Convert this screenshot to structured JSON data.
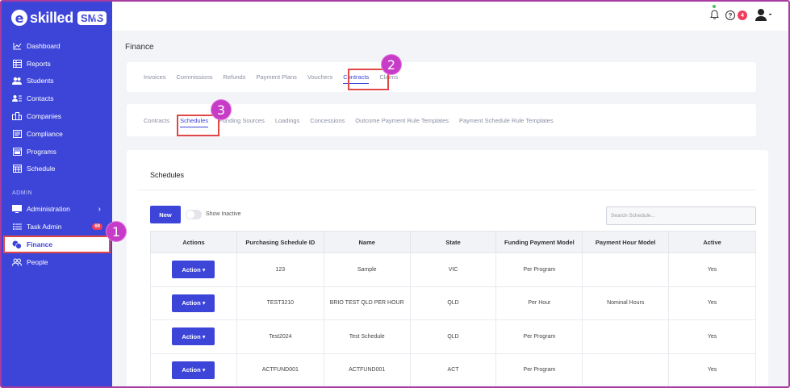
{
  "sidebar": {
    "logo": {
      "e": "e",
      "text": "skilled",
      "badge": "SMS"
    },
    "collapse_icon": "«",
    "items": [
      {
        "label": "Dashboard",
        "icon": "chart-line-icon"
      },
      {
        "label": "Reports",
        "icon": "table-icon"
      },
      {
        "label": "Students",
        "icon": "users-icon"
      },
      {
        "label": "Contacts",
        "icon": "contact-card-icon"
      },
      {
        "label": "Companies",
        "icon": "building-icon"
      },
      {
        "label": "Compliance",
        "icon": "check-list-icon"
      },
      {
        "label": "Programs",
        "icon": "window-icon"
      },
      {
        "label": "Schedule",
        "icon": "calendar-icon"
      }
    ],
    "admin_label": "ADMIN",
    "admin_items": [
      {
        "label": "Administration",
        "icon": "monitor-icon"
      },
      {
        "label": "Task Admin",
        "icon": "list-icon",
        "badge": "69"
      },
      {
        "label": "Finance",
        "icon": "coins-icon"
      },
      {
        "label": "People",
        "icon": "people-icon"
      }
    ]
  },
  "topbar": {
    "help_badge": "4"
  },
  "page": {
    "title": "Finance"
  },
  "finance_tabs": [
    "Invoices",
    "Commissions",
    "Refunds",
    "Payment Plans",
    "Vouchers",
    "Contracts",
    "Claims"
  ],
  "contract_tabs": [
    "Contracts",
    "Schedules",
    "Funding Sources",
    "Loadings",
    "Concessions",
    "Outcome Payment Rule Templates",
    "Payment Schedule Rule Templates"
  ],
  "schedules": {
    "title": "Schedules",
    "new_label": "New",
    "show_inactive_label": "Show Inactive",
    "search_placeholder": "Search Schedule...",
    "columns": [
      "Actions",
      "Purchasing Schedule ID",
      "Name",
      "State",
      "Funding Payment Model",
      "Payment Hour Model",
      "Active"
    ],
    "action_label": "Action",
    "rows": [
      [
        "123",
        "Sample",
        "VIC",
        "Per Program",
        "",
        "Yes"
      ],
      [
        "TEST3210",
        "BRIO TEST QLD PER HOUR",
        "QLD",
        "Per Hour",
        "Nominal Hours",
        "Yes"
      ],
      [
        "Test2024",
        "Test Schedule",
        "QLD",
        "Per Program",
        "",
        "Yes"
      ],
      [
        "ACTFUND001",
        "ACTFUND001",
        "ACT",
        "Per Program",
        "",
        "Yes"
      ]
    ]
  },
  "callouts": [
    "1",
    "2",
    "3"
  ],
  "colors": {
    "primary": "#3d45d9",
    "highlight": "#e04848",
    "callout": "#c63cc6",
    "badge": "#ef3e5c"
  }
}
